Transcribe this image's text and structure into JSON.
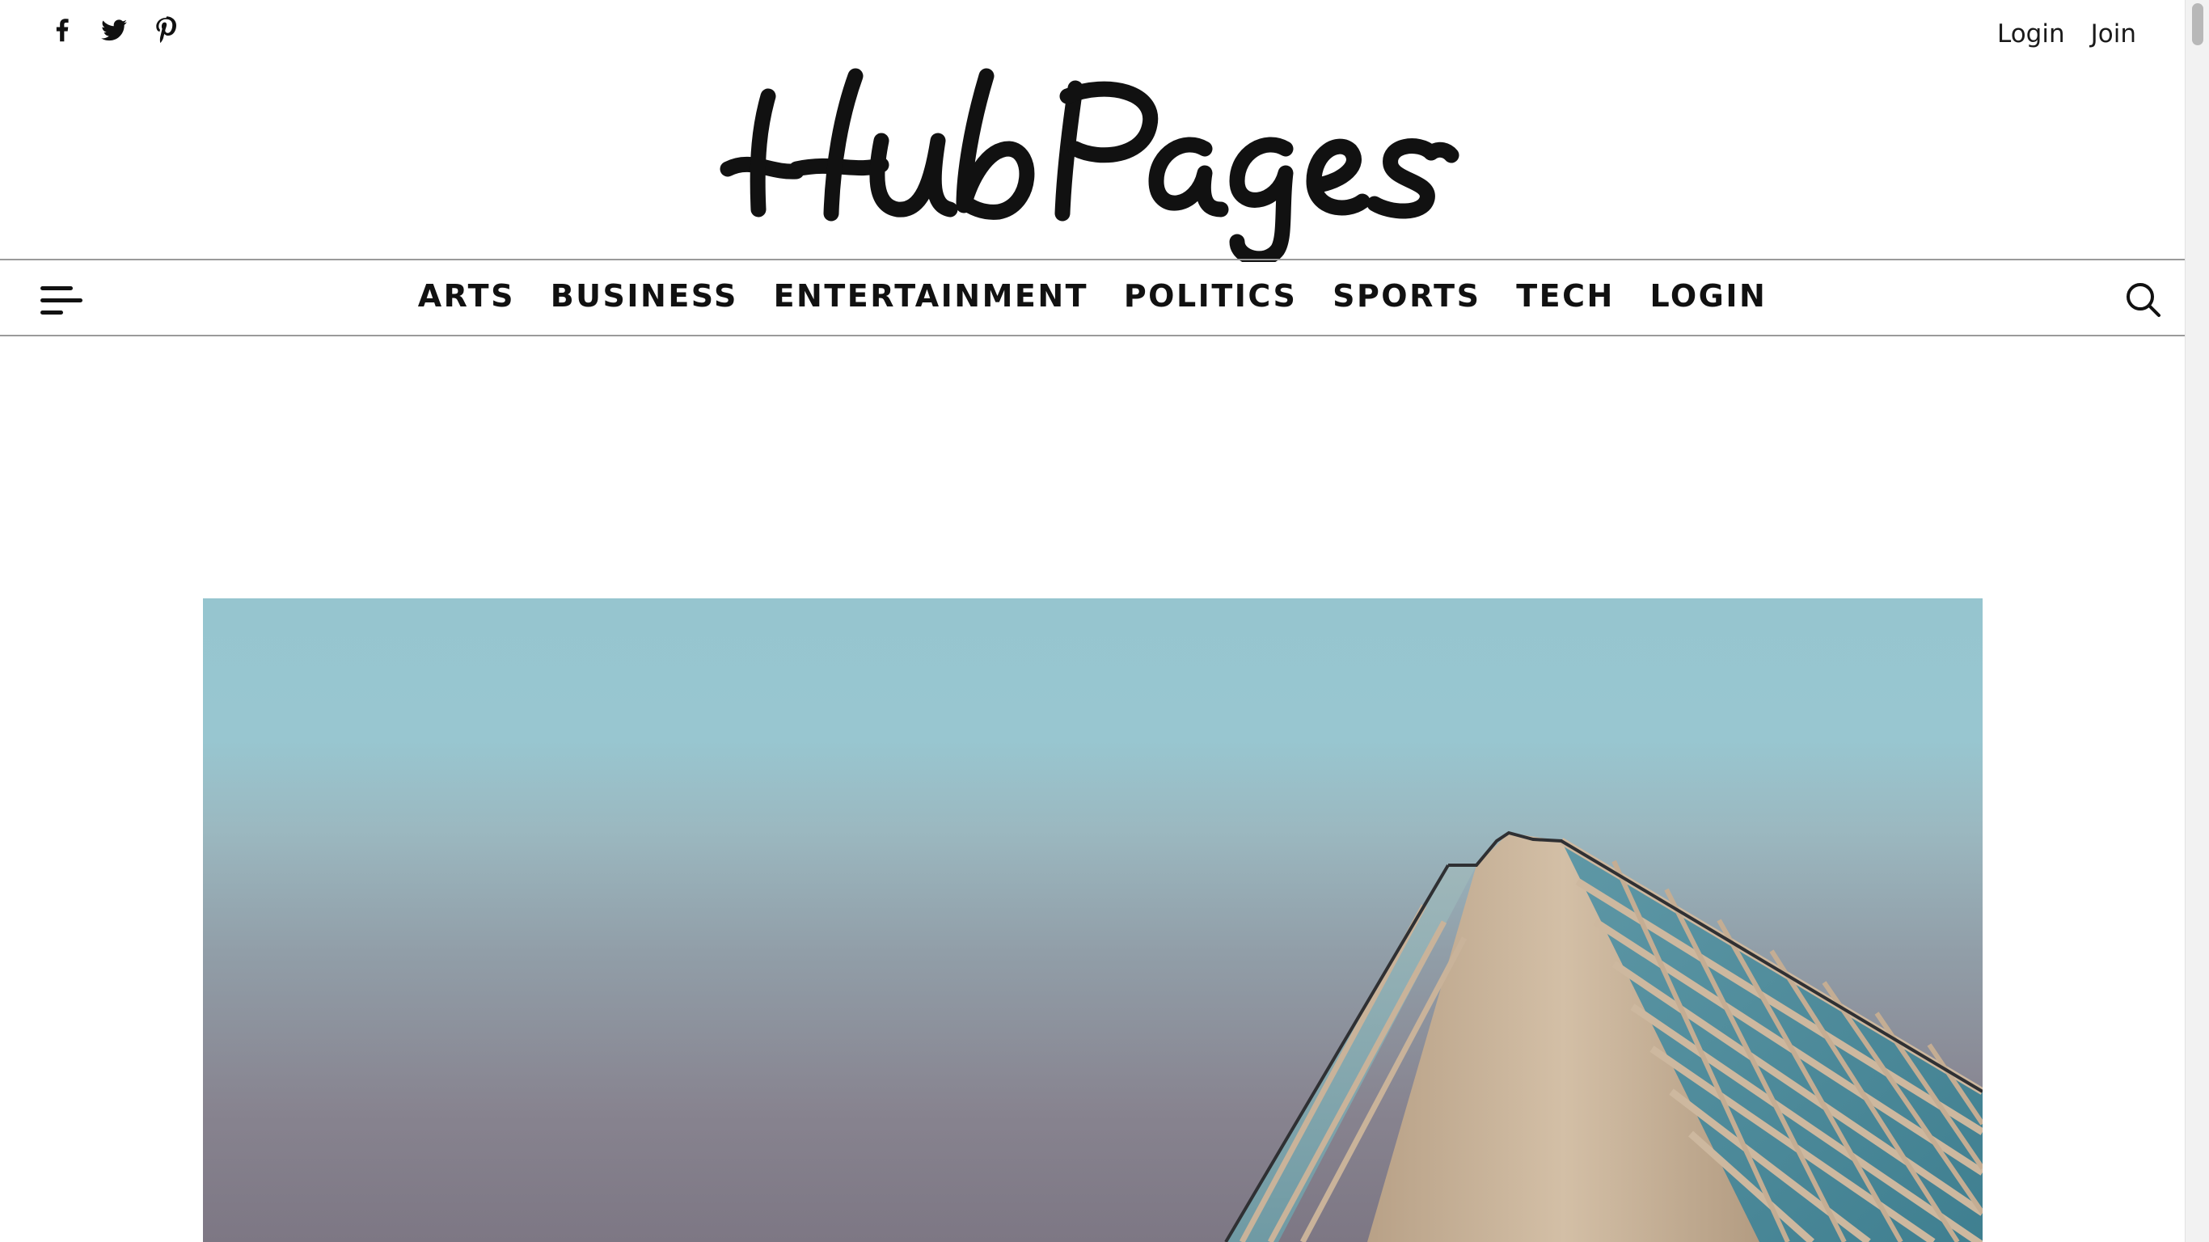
{
  "social": {
    "icons": [
      "facebook-icon",
      "twitter-icon",
      "pinterest-icon"
    ]
  },
  "account": {
    "login_label": "Login",
    "join_label": "Join"
  },
  "logo": {
    "text": "HubPages"
  },
  "nav": {
    "menu_icon": "hamburger-menu-icon",
    "search_icon": "search-icon",
    "items": [
      {
        "label": "ARTS"
      },
      {
        "label": "BUSINESS"
      },
      {
        "label": "ENTERTAINMENT"
      },
      {
        "label": "POLITICS"
      },
      {
        "label": "SPORTS"
      },
      {
        "label": "TECH"
      },
      {
        "label": "LOGIN"
      }
    ]
  },
  "hero": {
    "image": "building-corner-photo"
  },
  "colors": {
    "text": "#111111",
    "divider": "#9a9a9a",
    "sky_top": "#96c5cf",
    "sky_bottom": "#7d7784",
    "building": "#c2ad93"
  }
}
